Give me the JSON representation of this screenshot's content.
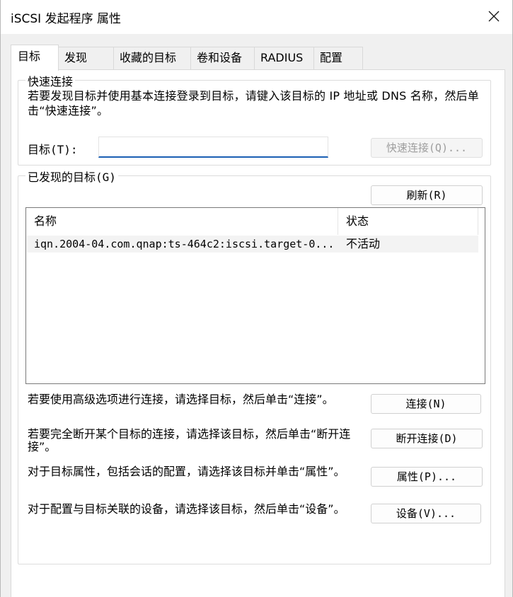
{
  "window": {
    "title": "iSCSI 发起程序 属性"
  },
  "tabs": [
    {
      "label": "目标",
      "active": true
    },
    {
      "label": "发现",
      "active": false
    },
    {
      "label": "收藏的目标",
      "active": false
    },
    {
      "label": "卷和设备",
      "active": false
    },
    {
      "label": "RADIUS",
      "active": false
    },
    {
      "label": "配置",
      "active": false
    }
  ],
  "quick_connect": {
    "legend": "快速连接",
    "description": "若要发现目标并使用基本连接登录到目标，请键入该目标的 IP 地址或 DNS 名称，然后单击“快速连接”。",
    "target_label": "目标(T):",
    "target_value": "",
    "button_label": "快速连接(Q)..."
  },
  "discovered": {
    "legend": "已发现的目标(G)",
    "refresh_label": "刷新(R)",
    "columns": [
      "名称",
      "状态"
    ],
    "rows": [
      {
        "name": "iqn.2004-04.com.qnap:ts-464c2:iscsi.target-0...",
        "status": "不活动"
      }
    ]
  },
  "actions": [
    {
      "text": "若要使用高级选项进行连接，请选择目标，然后单击“连接”。",
      "button": "连接(N)"
    },
    {
      "text": "若要完全断开某个目标的连接，请选择该目标，然后单击“断开连接”。",
      "button": "断开连接(D)"
    },
    {
      "text": "对于目标属性，包括会话的配置，请选择该目标并单击“属性”。",
      "button": "属性(P)..."
    },
    {
      "text": "对于配置与目标关联的设备，请选择该目标，然后单击“设备”。",
      "button": "设备(V)..."
    }
  ],
  "colors": {
    "accent": "#1a5fb4",
    "panel": "#ffffff",
    "chrome": "#f0f0f0"
  }
}
